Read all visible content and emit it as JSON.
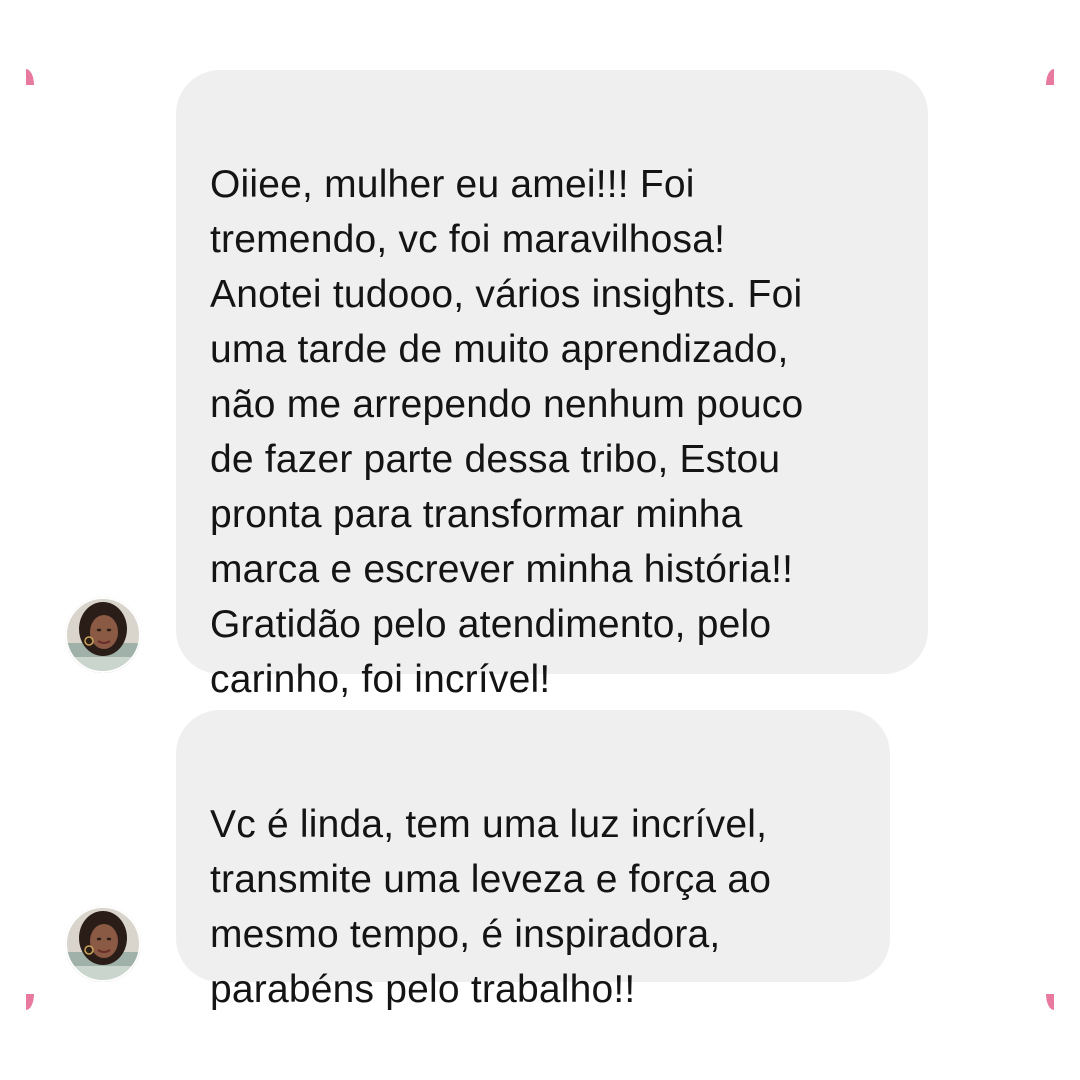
{
  "colors": {
    "corner_accent": "#e8799f",
    "bubble_background": "#efefef",
    "text": "#141414"
  },
  "messages": [
    {
      "avatar_icon": "user-avatar-photo",
      "text": "Oiiee, mulher eu amei!!! Foi\ntremendo, vc foi maravilhosa!\nAnotei tudooo, vários insights. Foi\numa tarde de muito aprendizado,\nnão me arrependo nenhum pouco\nde fazer parte dessa tribo,  Estou\npronta para transformar minha\nmarca e escrever minha história!!\nGratidão pelo atendimento, pelo\ncarinho, foi incrível!"
    },
    {
      "avatar_icon": "user-avatar-photo",
      "text": "Vc é linda, tem uma luz incrível,\ntransmite uma leveza e força ao\nmesmo tempo, é inspiradora,\nparabéns pelo trabalho!!"
    }
  ]
}
